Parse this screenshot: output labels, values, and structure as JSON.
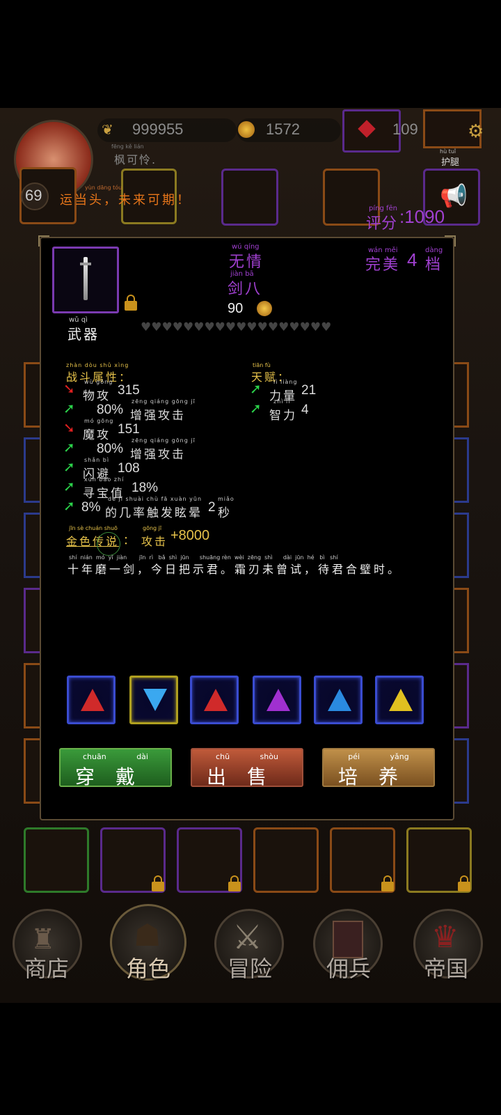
{
  "header": {
    "wings": "999955",
    "coins": "1572",
    "gems": "109",
    "player_name": "枫可怜.",
    "player_name_pinyin": "fēng kě lián",
    "level": "69",
    "motto": "运当头，未来可期！",
    "motto_pinyin": "yùn dāng tóu",
    "score_label": "评分",
    "score_pinyin": "píng  fēn",
    "score_value": ":1090",
    "slot_label_right": "护腿",
    "slot_label_right_pinyin": "hù  tuǐ"
  },
  "item": {
    "name_line1": "无情",
    "name_line1_pinyin": "wú  qíng",
    "name_line2": "剑八",
    "name_line2_pinyin": "jiàn  bā",
    "price": "90",
    "type": "武器",
    "type_pinyin": "wǔ   qì",
    "quality": "完美",
    "quality_pinyin": "wán  měi",
    "tier_num": "4",
    "tier_unit": "档",
    "tier_pinyin": "dàng"
  },
  "combat": {
    "title": "战斗属性：",
    "title_pinyin": "zhàn dòu shǔ xìng",
    "rows": [
      {
        "arrow": "down",
        "text": "物攻",
        "pinyin": "wù gōng",
        "value": "315"
      },
      {
        "arrow": "up",
        "text": "增强攻击",
        "pinyin": "zēng qiáng gōng  jī",
        "value": "80%"
      },
      {
        "arrow": "down",
        "text": "魔攻",
        "pinyin": "mó gōng",
        "value": "151"
      },
      {
        "arrow": "up",
        "text": "增强攻击",
        "pinyin": "zēng qiáng gōng  jī",
        "value": "80%"
      },
      {
        "arrow": "up",
        "text": "闪避",
        "pinyin": "shǎn  bì",
        "value": "108"
      },
      {
        "arrow": "up",
        "text": "寻宝值",
        "pinyin": "xún bǎo zhí",
        "value": "18%"
      },
      {
        "arrow": "up",
        "text": "的几率触发眩晕",
        "pinyin": "de  jǐ  shuài chù  fā  xuàn yūn",
        "value": "8%",
        "suffix": "2",
        "suffix_unit": "秒",
        "suffix_pinyin": "miǎo"
      }
    ]
  },
  "talent": {
    "title": "天赋：",
    "title_pinyin": "tiān  fù",
    "rows": [
      {
        "text": "力量",
        "pinyin": "lì  liàng",
        "value": "21"
      },
      {
        "text": "智力",
        "pinyin": "zhì  lì",
        "value": "4"
      }
    ]
  },
  "legend": {
    "label": "金色传说",
    "label_pinyin": "jīn  sè  chuán shuō",
    "colon": "：",
    "effect": "攻击",
    "effect_pinyin": "gōng  jī",
    "value": "+8000"
  },
  "poem": {
    "text": "十年磨一剑，今日把示君。霜刃未曾试，待君合璧时。",
    "pinyin": "shí  nián  mó  yī  jiàn       jīn  rì   bǎ  shì  jūn      shuāng rèn  wèi  zēng  shì      dài  jūn  hé   bì   shí"
  },
  "gems": [
    "red",
    "blue",
    "red",
    "purple",
    "blue",
    "yellow"
  ],
  "actions": {
    "wear": "穿戴",
    "wear_pinyin": "chuān  dài",
    "sell": "出售",
    "sell_pinyin": "chū  shòu",
    "train": "培养",
    "train_pinyin": "péi  yǎng"
  },
  "nav": {
    "shop": "商店",
    "character": "角色",
    "adventure": "冒险",
    "mercenary": "佣兵",
    "empire": "帝国"
  },
  "colors": {
    "gold_text": "#e6c24a",
    "purple_text": "#a040d0",
    "stat_up": "#2bd24a",
    "stat_down": "#e02020"
  }
}
